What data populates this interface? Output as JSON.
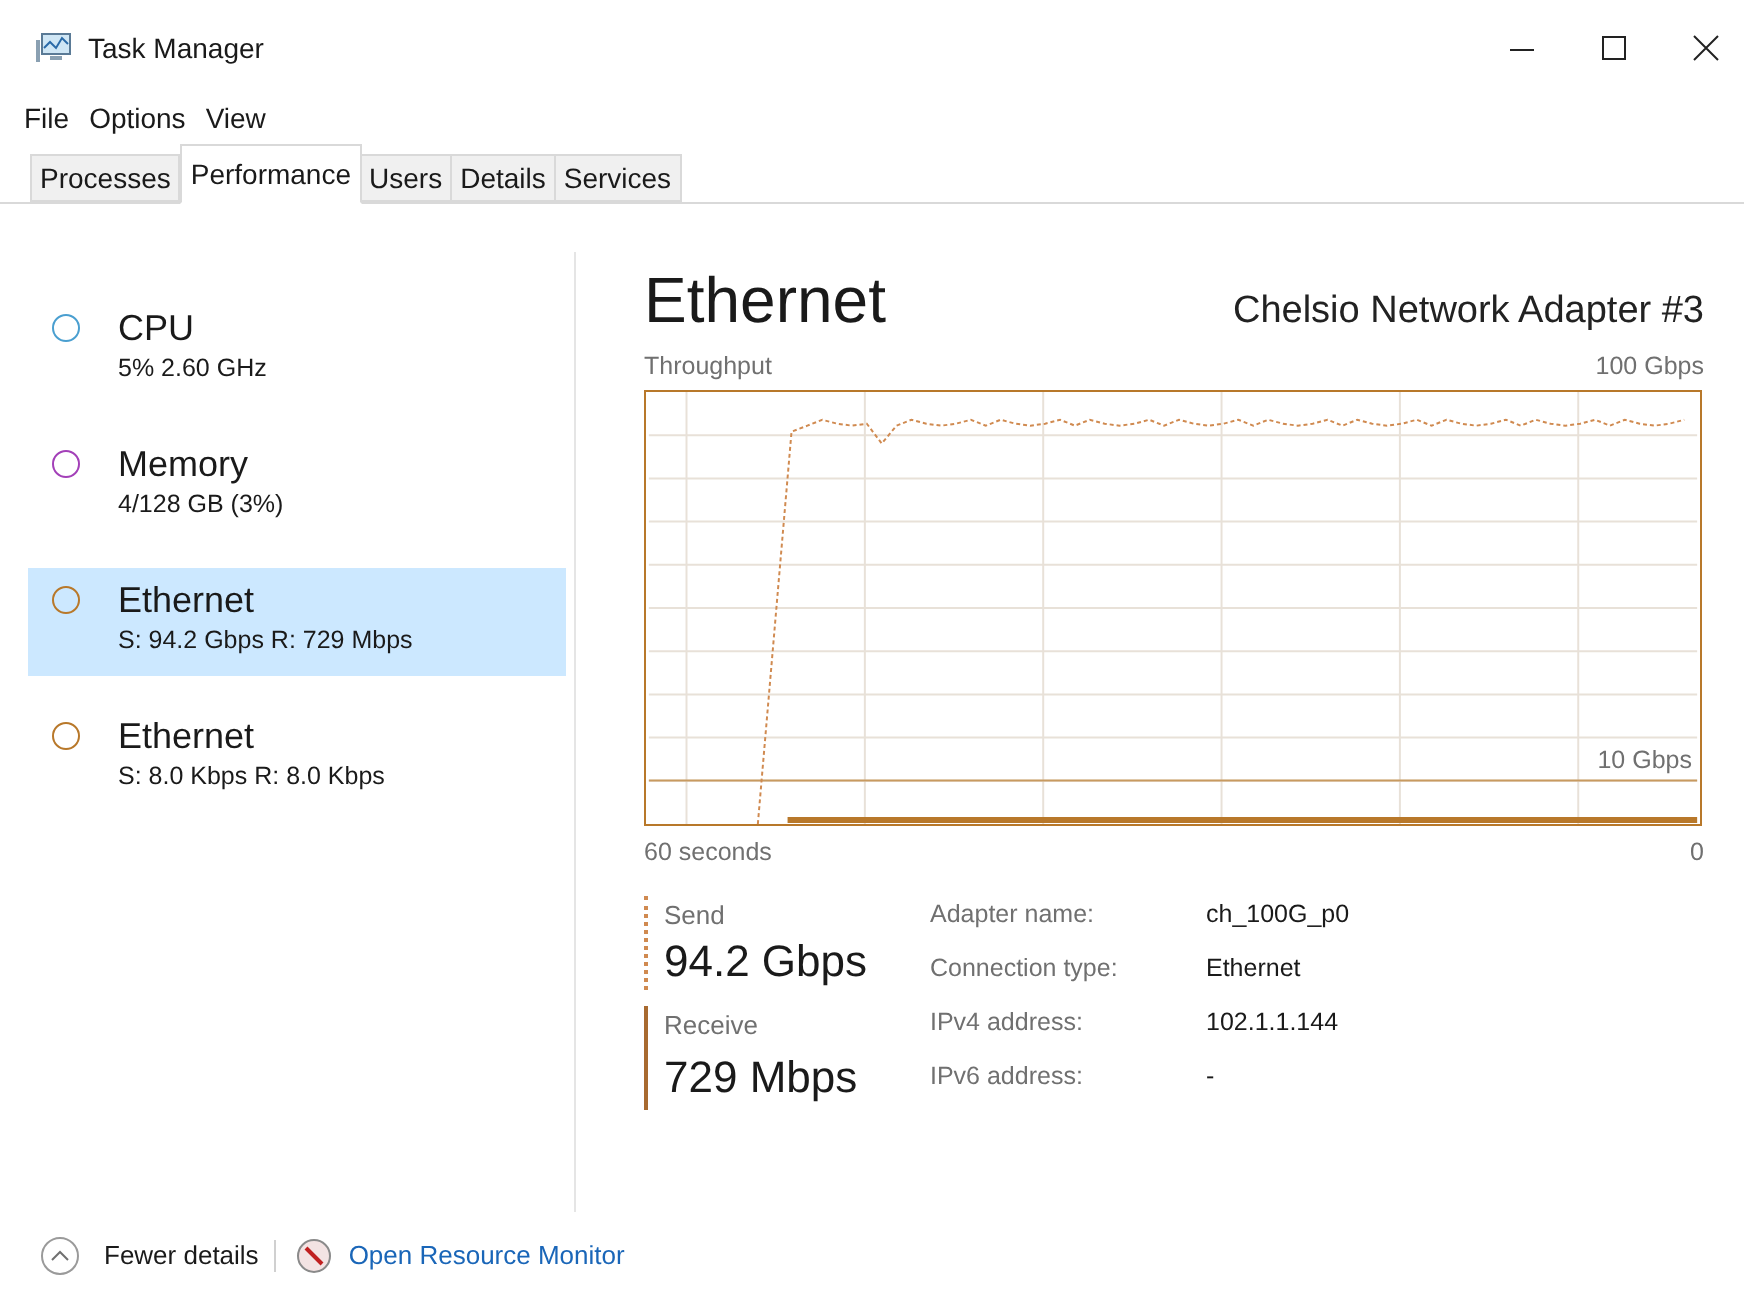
{
  "window": {
    "title": "Task Manager"
  },
  "menu": [
    "File",
    "Options",
    "View"
  ],
  "tabs": [
    {
      "label": "Processes",
      "selected": false
    },
    {
      "label": "Performance",
      "selected": true
    },
    {
      "label": "Users",
      "selected": false
    },
    {
      "label": "Details",
      "selected": false
    },
    {
      "label": "Services",
      "selected": false
    }
  ],
  "sidebar": {
    "items": [
      {
        "name": "CPU",
        "detail": "5% 2.60 GHz",
        "color": "#4a9fd0",
        "selected": false
      },
      {
        "name": "Memory",
        "detail": "4/128 GB (3%)",
        "color": "#a340b8",
        "selected": false
      },
      {
        "name": "Ethernet",
        "detail": "S: 94.2 Gbps R: 729 Mbps",
        "color": "#b8782a",
        "selected": true
      },
      {
        "name": "Ethernet",
        "detail": "S: 8.0 Kbps R: 8.0 Kbps",
        "color": "#b8782a",
        "selected": false
      }
    ]
  },
  "panel": {
    "title": "Ethernet",
    "subtitle": "Chelsio Network Adapter #3",
    "graph": {
      "label": "Throughput",
      "max": "100 Gbps",
      "scale": "10 Gbps",
      "time_start": "60 seconds",
      "time_end": "0"
    },
    "send": {
      "label": "Send",
      "value": "94.2 Gbps"
    },
    "receive": {
      "label": "Receive",
      "value": "729 Mbps"
    },
    "properties": [
      {
        "label": "Adapter name:",
        "value": "ch_100G_p0"
      },
      {
        "label": "Connection type:",
        "value": "Ethernet"
      },
      {
        "label": "IPv4 address:",
        "value": "102.1.1.144"
      },
      {
        "label": "IPv6 address:",
        "value": "-"
      }
    ]
  },
  "footer": {
    "fewer_details": "Fewer details",
    "resource_monitor": "Open Resource Monitor"
  }
}
